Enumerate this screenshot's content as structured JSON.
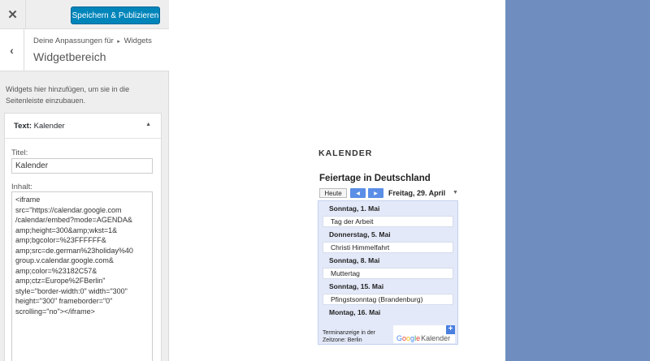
{
  "topbar": {
    "close_glyph": "✕",
    "save_label": "Speichern & Publizieren"
  },
  "panel": {
    "back_glyph": "‹",
    "breadcrumb_prefix": "Deine Anpassungen für",
    "breadcrumb_arrow": "▸",
    "breadcrumb_section": "Widgets",
    "title": "Widgetbereich"
  },
  "description": "Widgets hier hinzufügen, um sie in die Seitenleiste einzubauen.",
  "widget": {
    "type_label": "Text:",
    "name": "Kalender",
    "toggle_glyph": "▲",
    "title_label": "Titel:",
    "title_value": "Kalender",
    "content_label": "Inhalt:",
    "content_value": "<iframe\nsrc=\"https://calendar.google.com\n/calendar/embed?mode=AGENDA&\namp;height=300&amp;wkst=1&\namp;bgcolor=%23FFFFFF&\namp;src=de.german%23holiday%40\ngroup.v.calendar.google.com&\namp;color=%23182C57&\namp;ctz=Europe%2FBerlin\"\nstyle=\"border-width:0\" width=\"300\"\nheight=\"300\" frameborder=\"0\"\nscrolling=\"no\"></iframe>"
  },
  "preview": {
    "heading": "KALENDER",
    "band_color": "#6f8ebf"
  },
  "calendar": {
    "title": "Feiertage in Deutschland",
    "today_label": "Heute",
    "prev_glyph": "◀",
    "next_glyph": "▶",
    "current_date": "Freitag, 29. April",
    "date_dropdown_glyph": "▼",
    "days": [
      {
        "heading": "Sonntag, 1. Mai",
        "event": "Tag der Arbeit"
      },
      {
        "heading": "Donnerstag, 5. Mai",
        "event": "Christi Himmelfahrt"
      },
      {
        "heading": "Sonntag, 8. Mai",
        "event": "Muttertag"
      },
      {
        "heading": "Sonntag, 15. Mai",
        "event": "Pfingstsonntag (Brandenburg)"
      },
      {
        "heading": "Montag, 16. Mai",
        "event": ""
      }
    ],
    "timezone_line1": "Terminanzeige in der",
    "timezone_line2": "Zeitzone: Berlin",
    "add_glyph": "+",
    "logo_letters": [
      "G",
      "o",
      "o",
      "g",
      "l",
      "e"
    ],
    "logo_suffix": "Kalender"
  }
}
